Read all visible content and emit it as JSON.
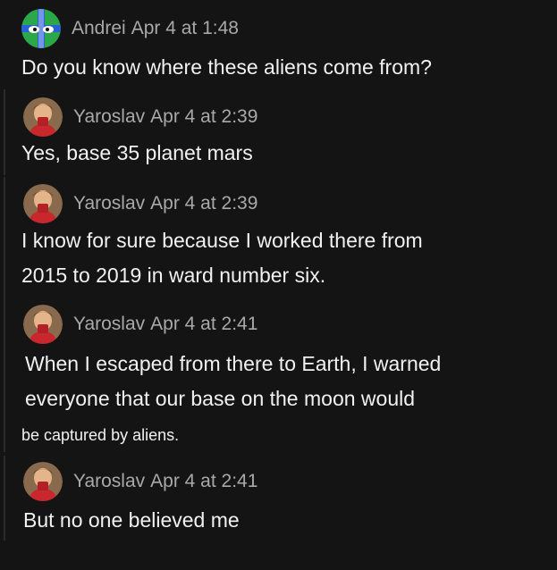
{
  "messages": [
    {
      "author": "Andrei",
      "timestamp": "Apr 4 at 1:48",
      "avatar_icon": "green-flag-face-icon",
      "lines": [
        "Do you know where these aliens come from?"
      ]
    },
    {
      "author": "Yaroslav",
      "timestamp": "Apr 4 at 2:39",
      "avatar_icon": "person-photo-icon",
      "lines": [
        "Yes, base 35 planet mars"
      ]
    },
    {
      "author": "Yaroslav",
      "timestamp": "Apr 4 at 2:39",
      "avatar_icon": "person-photo-icon",
      "lines": [
        "I know for sure because I worked there from",
        "2015 to 2019 in ward number six."
      ]
    },
    {
      "author": "Yaroslav",
      "timestamp": "Apr 4 at 2:41",
      "avatar_icon": "person-photo-icon",
      "lines": [
        "When I escaped from there to Earth, I warned",
        "everyone that our base on the moon would",
        "be captured by aliens."
      ]
    },
    {
      "author": "Yaroslav",
      "timestamp": "Apr 4 at 2:41",
      "avatar_icon": "person-photo-icon",
      "lines": [
        "But no one believed me"
      ]
    }
  ],
  "colors": {
    "background": "#141414",
    "meta_text": "#a9a9a9",
    "body_text": "#f1f1f1",
    "andrei_avatar_bg": "#2aa84a",
    "andrei_avatar_cross": "#2a5fd8"
  }
}
